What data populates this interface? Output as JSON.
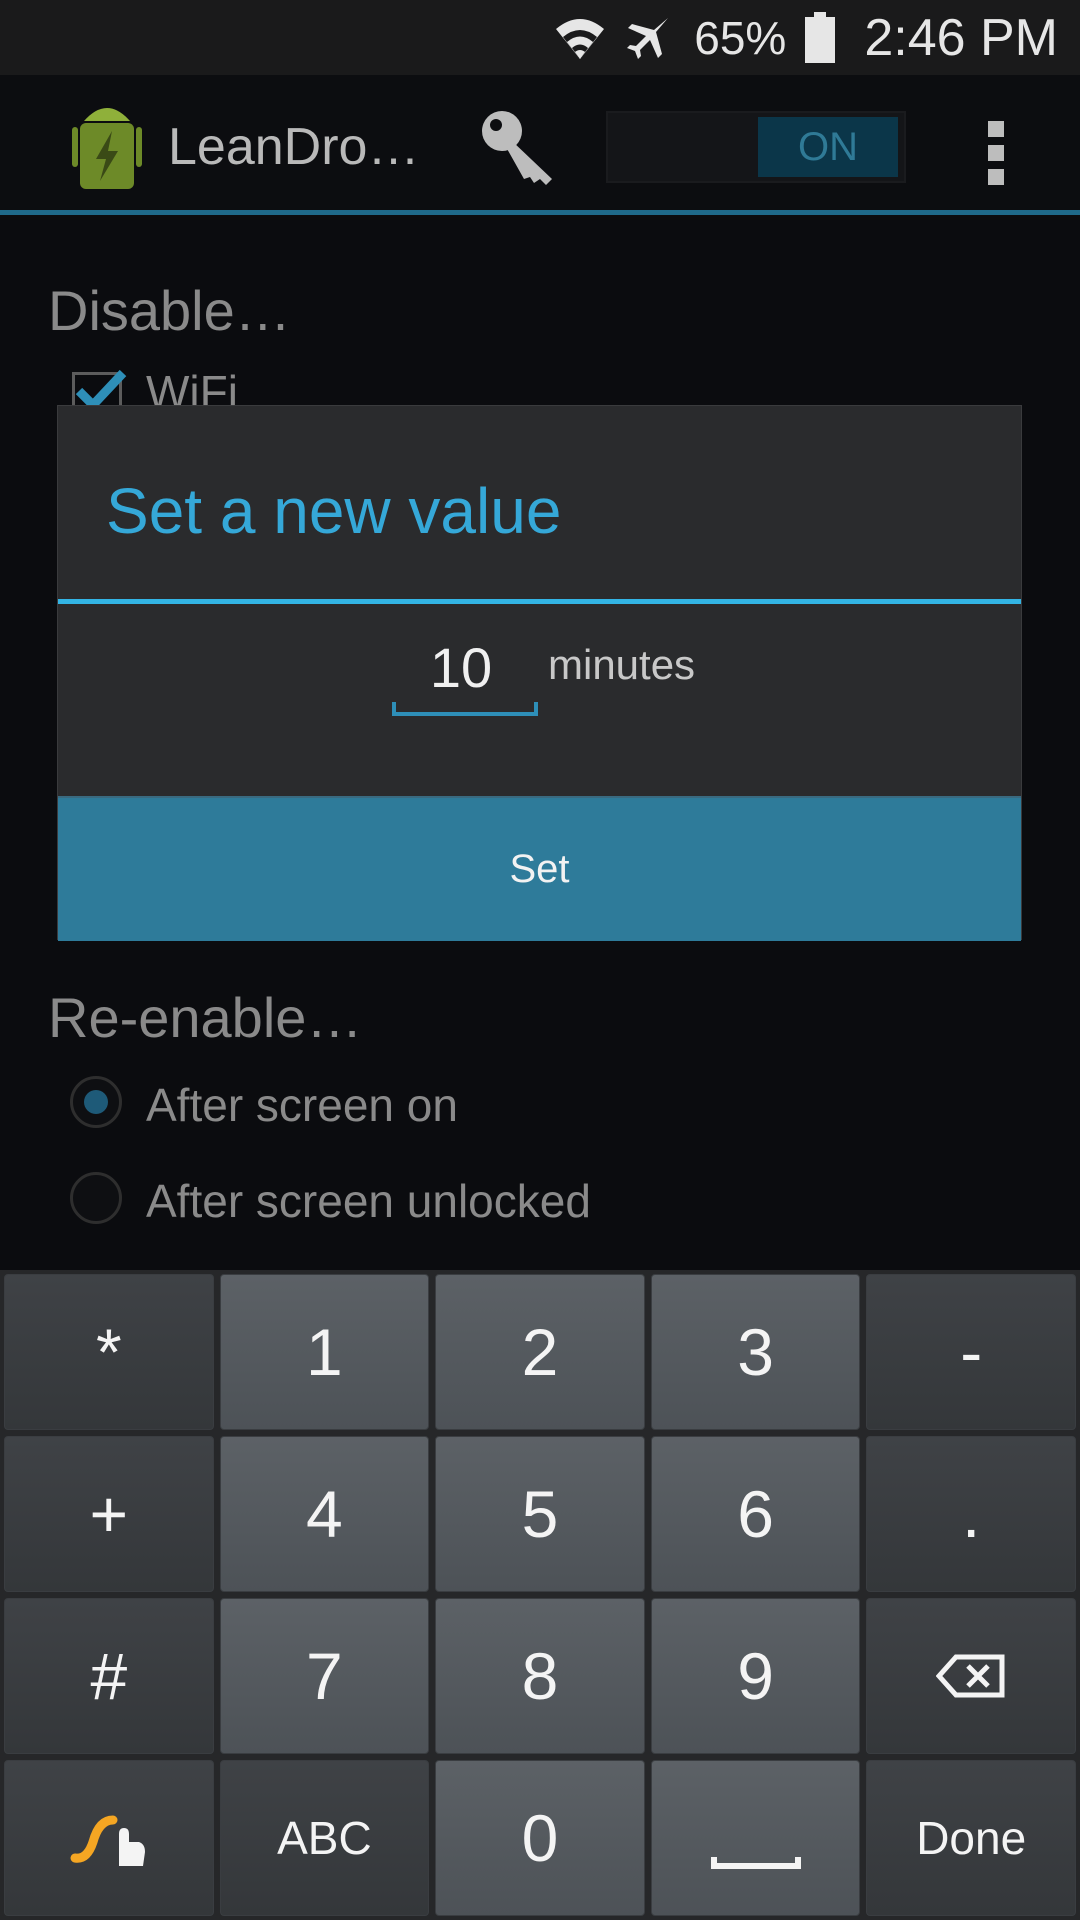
{
  "status_bar": {
    "battery_percent": "65%",
    "time": "2:46 PM",
    "icons": [
      "wifi-icon",
      "airplane-icon",
      "battery-icon"
    ]
  },
  "action_bar": {
    "app_title": "LeanDro…",
    "toggle_label": "ON",
    "icons": [
      "app-icon",
      "key-icon",
      "overflow-menu-icon"
    ]
  },
  "content": {
    "disable_title": "Disable…",
    "wifi_label": "WiFi",
    "wifi_checked": true,
    "reenable_title": "Re-enable…",
    "radio_options": [
      {
        "label": "After screen on",
        "selected": true
      },
      {
        "label": "After screen unlocked",
        "selected": false
      }
    ]
  },
  "dialog": {
    "title": "Set a new value",
    "value": "10",
    "unit": "minutes",
    "button_label": "Set"
  },
  "keyboard": {
    "rows": [
      [
        "*",
        "1",
        "2",
        "3",
        "-"
      ],
      [
        "+",
        "4",
        "5",
        "6",
        "."
      ],
      [
        "#",
        "7",
        "8",
        "9",
        "⌫"
      ],
      [
        "",
        "ABC",
        "0",
        " ",
        "Done"
      ]
    ],
    "icons": [
      "swype-icon",
      "backspace-icon",
      "space-icon"
    ]
  },
  "colors": {
    "accent": "#33b5e5",
    "button": "#2e7b9a",
    "dialog_bg": "#2a2b2d",
    "swype_orange": "#f5a623"
  }
}
